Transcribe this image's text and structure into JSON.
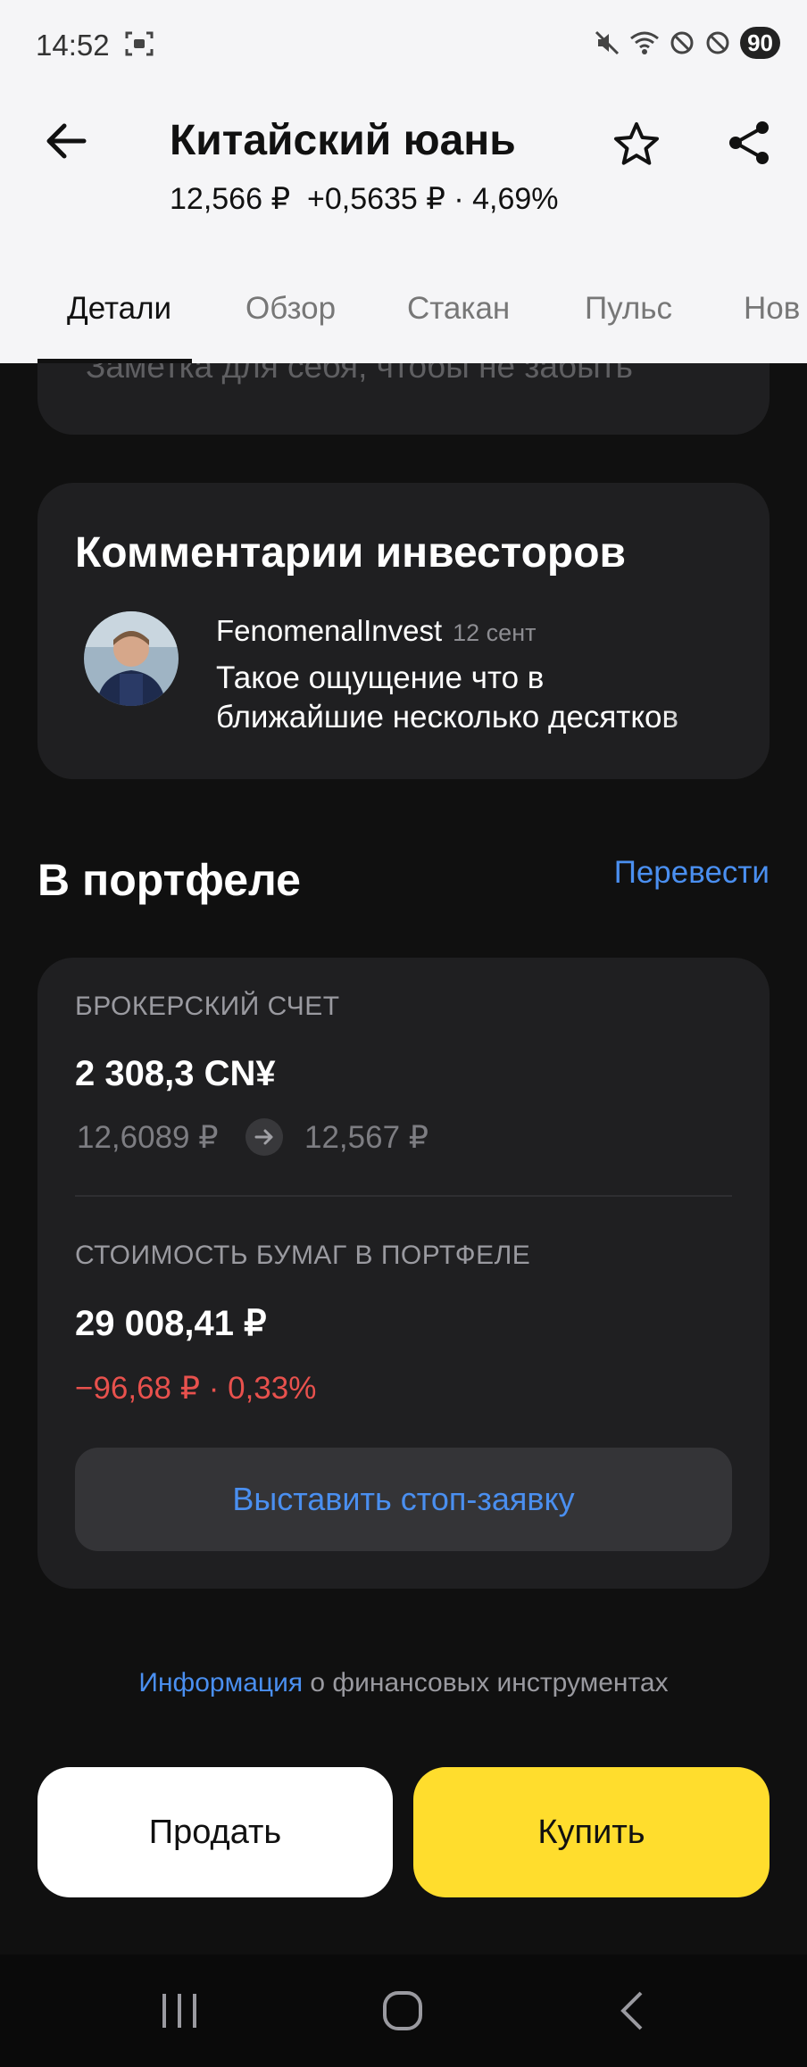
{
  "status_bar": {
    "time": "14:52",
    "battery": "90"
  },
  "header": {
    "title": "Китайский юань",
    "price": "12,566 ₽",
    "change": "+0,5635 ₽ · 4,69%"
  },
  "tabs": [
    {
      "label": "Детали"
    },
    {
      "label": "Обзор"
    },
    {
      "label": "Стакан"
    },
    {
      "label": "Пульс"
    },
    {
      "label": "Нов"
    }
  ],
  "note": {
    "placeholder": "Заметка для себя, чтобы не забыть"
  },
  "comments": {
    "title": "Комментарии инвесторов",
    "author": "FenomenalInvest",
    "date": "12 сент",
    "text": "Такое ощущение что в ближайшие несколько десятков"
  },
  "portfolio": {
    "title": "В портфеле",
    "transfer_label": "Перевести",
    "broker_label": "БРОКЕРСКИЙ СЧЕТ",
    "broker_amount": "2 308,3 CN¥",
    "avg_price": "12,6089 ₽",
    "current_price": "12,567 ₽",
    "value_label": "СТОИМОСТЬ БУМАГ В ПОРТФЕЛЕ",
    "value_amount": "29 008,41 ₽",
    "value_change": "−96,68 ₽ · 0,33%",
    "stop_order_label": "Выставить стоп-заявку"
  },
  "info": {
    "link": "Информация",
    "rest": " о финансовых инструментах"
  },
  "actions": {
    "sell_label": "Продать",
    "buy_label": "Купить"
  },
  "colors": {
    "accent_blue": "#4a8ff0",
    "buy_yellow": "#ffdd2d",
    "negative_red": "#e8514d"
  }
}
